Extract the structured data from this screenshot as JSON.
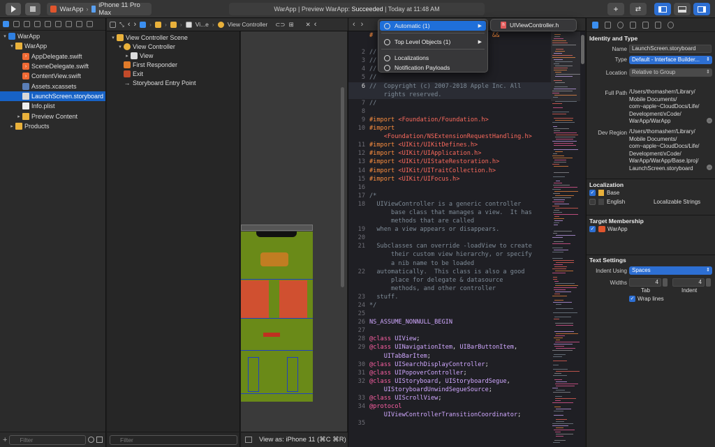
{
  "toolbar": {
    "scheme_name": "WarApp",
    "device": "iPhone 11 Pro Max",
    "status_prefix": "WarApp | Preview WarApp:",
    "status_result": "Succeeded",
    "status_time": "| Today at 11:48 AM"
  },
  "navigator": {
    "items": [
      {
        "label": "WarApp",
        "icon": "app-icon",
        "indent": 0,
        "disclosure": "▾",
        "selected": false
      },
      {
        "label": "WarApp",
        "icon": "folder-icon",
        "indent": 1,
        "disclosure": "▾",
        "selected": false
      },
      {
        "label": "AppDelegate.swift",
        "icon": "swift-file-icon",
        "indent": 2,
        "disclosure": "",
        "selected": false
      },
      {
        "label": "SceneDelegate.swift",
        "icon": "swift-file-icon",
        "indent": 2,
        "disclosure": "",
        "selected": false
      },
      {
        "label": "ContentView.swift",
        "icon": "swift-file-icon",
        "indent": 2,
        "disclosure": "",
        "selected": false
      },
      {
        "label": "Assets.xcassets",
        "icon": "assets-icon",
        "indent": 2,
        "disclosure": "",
        "selected": false
      },
      {
        "label": "LaunchScreen.storyboard",
        "icon": "storyboard-icon",
        "indent": 2,
        "disclosure": "",
        "selected": true
      },
      {
        "label": "Info.plist",
        "icon": "plist-icon",
        "indent": 2,
        "disclosure": "",
        "selected": false
      },
      {
        "label": "Preview Content",
        "icon": "folder-icon",
        "indent": 2,
        "disclosure": "▸",
        "selected": false
      },
      {
        "label": "Products",
        "icon": "folder-icon",
        "indent": 1,
        "disclosure": "▸",
        "selected": false
      }
    ],
    "filter_placeholder": "Filter"
  },
  "jumpbar": {
    "crumbs": [
      "Vi...e",
      "View Controller"
    ]
  },
  "outline": {
    "items": [
      {
        "label": "View Controller Scene",
        "indent": 0,
        "disclosure": "▾",
        "icon": "scene-icon"
      },
      {
        "label": "View Controller",
        "indent": 1,
        "disclosure": "▾",
        "icon": "view-controller-icon"
      },
      {
        "label": "View",
        "indent": 2,
        "disclosure": "▸",
        "icon": "view-icon"
      },
      {
        "label": "First Responder",
        "indent": 1,
        "disclosure": "",
        "icon": "first-responder-icon"
      },
      {
        "label": "Exit",
        "indent": 1,
        "disclosure": "",
        "icon": "exit-icon"
      },
      {
        "label": "Storyboard Entry Point",
        "indent": 1,
        "disclosure": "",
        "icon": "entry-arrow-icon"
      }
    ],
    "filter_placeholder": "Filter"
  },
  "canvas": {
    "view_as": "View as: iPhone 11 (⌘C ⌘R)"
  },
  "menu": {
    "items": [
      {
        "label": "Automatic (1)",
        "selected": true,
        "submenu": true
      },
      {
        "label": "Top Level Objects (1)",
        "selected": false,
        "submenu": true
      },
      {
        "label": "Localizations",
        "selected": false,
        "submenu": false
      },
      {
        "label": "Notification Payloads",
        "selected": false,
        "submenu": false
      }
    ],
    "submenu_item": "UIViewController.h"
  },
  "code": {
    "lines": [
      {
        "n": "",
        "parts": [
          [
            "c-pre",
            "#"
          ],
          [
            "tx",
            "                          "
          ],
          [
            "c-pre",
            "ADERS) &&"
          ]
        ]
      },
      {
        "n": "",
        "parts": [
          [
            "tx",
            ""
          ]
        ]
      },
      {
        "n": "",
        "parts": [
          [
            "tx",
            "                           "
          ],
          [
            "c-str",
            "h>)"
          ]
        ]
      },
      {
        "n": "2",
        "parts": [
          [
            "c-com",
            "//"
          ]
        ]
      },
      {
        "n": "3",
        "parts": [
          [
            "c-com",
            "//  UIViewController.h"
          ]
        ]
      },
      {
        "n": "4",
        "parts": [
          [
            "c-com",
            "//  UIKit"
          ]
        ]
      },
      {
        "n": "5",
        "parts": [
          [
            "c-com",
            "//"
          ]
        ]
      },
      {
        "n": "6",
        "parts": [
          [
            "c-com",
            "//  Copyright (c) 2007-2018 Apple Inc. All"
          ]
        ],
        "hl": true
      },
      {
        "n": "",
        "parts": [
          [
            "c-com",
            "    rights reserved."
          ]
        ],
        "hl": true
      },
      {
        "n": "7",
        "parts": [
          [
            "c-com",
            "//"
          ]
        ]
      },
      {
        "n": "8",
        "parts": [
          [
            "tx",
            ""
          ]
        ]
      },
      {
        "n": "9",
        "parts": [
          [
            "c-pre",
            "#import "
          ],
          [
            "c-str",
            "<Foundation/Foundation.h>"
          ]
        ]
      },
      {
        "n": "10",
        "parts": [
          [
            "c-pre",
            "#import"
          ]
        ]
      },
      {
        "n": "",
        "parts": [
          [
            "c-str",
            "    <Foundation/NSExtensionRequestHandling.h>"
          ]
        ]
      },
      {
        "n": "11",
        "parts": [
          [
            "c-pre",
            "#import "
          ],
          [
            "c-str",
            "<UIKit/UIKitDefines.h>"
          ]
        ]
      },
      {
        "n": "12",
        "parts": [
          [
            "c-pre",
            "#import "
          ],
          [
            "c-str",
            "<UIKit/UIApplication.h>"
          ]
        ]
      },
      {
        "n": "13",
        "parts": [
          [
            "c-pre",
            "#import "
          ],
          [
            "c-str",
            "<UIKit/UIStateRestoration.h>"
          ]
        ]
      },
      {
        "n": "14",
        "parts": [
          [
            "c-pre",
            "#import "
          ],
          [
            "c-str",
            "<UIKit/UITraitCollection.h>"
          ]
        ]
      },
      {
        "n": "15",
        "parts": [
          [
            "c-pre",
            "#import "
          ],
          [
            "c-str",
            "<UIKit/UIFocus.h>"
          ]
        ]
      },
      {
        "n": "16",
        "parts": [
          [
            "tx",
            ""
          ]
        ]
      },
      {
        "n": "17",
        "parts": [
          [
            "c-com",
            "/*"
          ]
        ]
      },
      {
        "n": "18",
        "parts": [
          [
            "c-com",
            "  UIViewController is a generic controller"
          ]
        ]
      },
      {
        "n": "",
        "parts": [
          [
            "c-com",
            "      base class that manages a view.  It has"
          ]
        ]
      },
      {
        "n": "",
        "parts": [
          [
            "c-com",
            "      methods that are called"
          ]
        ]
      },
      {
        "n": "19",
        "parts": [
          [
            "c-com",
            "  when a view appears or disappears."
          ]
        ]
      },
      {
        "n": "20",
        "parts": [
          [
            "tx",
            ""
          ]
        ]
      },
      {
        "n": "21",
        "parts": [
          [
            "c-com",
            "  Subclasses can override -loadView to create"
          ]
        ]
      },
      {
        "n": "",
        "parts": [
          [
            "c-com",
            "      their custom view hierarchy, or specify"
          ]
        ]
      },
      {
        "n": "",
        "parts": [
          [
            "c-com",
            "      a nib name to be loaded"
          ]
        ]
      },
      {
        "n": "22",
        "parts": [
          [
            "c-com",
            "  automatically.  This class is also a good"
          ]
        ]
      },
      {
        "n": "",
        "parts": [
          [
            "c-com",
            "      place for delegate & datasource"
          ]
        ]
      },
      {
        "n": "",
        "parts": [
          [
            "c-com",
            "      methods, and other controller"
          ]
        ]
      },
      {
        "n": "23",
        "parts": [
          [
            "c-com",
            "  stuff."
          ]
        ]
      },
      {
        "n": "24",
        "parts": [
          [
            "c-com",
            "*/"
          ]
        ]
      },
      {
        "n": "25",
        "parts": [
          [
            "tx",
            ""
          ]
        ]
      },
      {
        "n": "26",
        "parts": [
          [
            "c-typ",
            "NS_ASSUME_NONNULL_BEGIN"
          ]
        ]
      },
      {
        "n": "27",
        "parts": [
          [
            "tx",
            ""
          ]
        ]
      },
      {
        "n": "28",
        "parts": [
          [
            "c-key",
            "@class "
          ],
          [
            "c-typ",
            "UIView"
          ],
          [
            "tx",
            ";"
          ]
        ]
      },
      {
        "n": "29",
        "parts": [
          [
            "c-key",
            "@class "
          ],
          [
            "c-typ",
            "UINavigationItem"
          ],
          [
            "tx",
            ", "
          ],
          [
            "c-typ",
            "UIBarButtonItem"
          ],
          [
            "tx",
            ","
          ]
        ]
      },
      {
        "n": "",
        "parts": [
          [
            "tx",
            "    "
          ],
          [
            "c-typ",
            "UITabBarItem"
          ],
          [
            "tx",
            ";"
          ]
        ]
      },
      {
        "n": "30",
        "parts": [
          [
            "c-key",
            "@class "
          ],
          [
            "c-typ",
            "UISearchDisplayController"
          ],
          [
            "tx",
            ";"
          ]
        ]
      },
      {
        "n": "31",
        "parts": [
          [
            "c-key",
            "@class "
          ],
          [
            "c-typ",
            "UIPopoverController"
          ],
          [
            "tx",
            ";"
          ]
        ]
      },
      {
        "n": "32",
        "parts": [
          [
            "c-key",
            "@class "
          ],
          [
            "c-typ",
            "UIStoryboard"
          ],
          [
            "tx",
            ", "
          ],
          [
            "c-typ",
            "UIStoryboardSegue"
          ],
          [
            "tx",
            ","
          ]
        ]
      },
      {
        "n": "",
        "parts": [
          [
            "tx",
            "    "
          ],
          [
            "c-typ",
            "UIStoryboardUnwindSegueSource"
          ],
          [
            "tx",
            ";"
          ]
        ]
      },
      {
        "n": "33",
        "parts": [
          [
            "c-key",
            "@class "
          ],
          [
            "c-typ",
            "UIScrollView"
          ],
          [
            "tx",
            ";"
          ]
        ]
      },
      {
        "n": "34",
        "parts": [
          [
            "c-key",
            "@protocol"
          ]
        ]
      },
      {
        "n": "",
        "parts": [
          [
            "tx",
            "    "
          ],
          [
            "c-typ",
            "UIViewControllerTransitionCoordinator"
          ],
          [
            "tx",
            ";"
          ]
        ]
      },
      {
        "n": "35",
        "parts": [
          [
            "tx",
            ""
          ]
        ]
      }
    ]
  },
  "inspector": {
    "identity_title": "Identity and Type",
    "name_label": "Name",
    "name_value": "LaunchScreen.storyboard",
    "type_label": "Type",
    "type_value": "Default - Interface Builder...",
    "location_label": "Location",
    "location_value": "Relative to Group",
    "full_path_label": "Full Path",
    "full_path_lines": [
      "/Users/thomasherr/Library/",
      "Mobile Documents/",
      "com~apple~CloudDocs/Life/",
      "Development/xCode/",
      "WarApp/WarApp"
    ],
    "dev_region_label": "Dev Region",
    "dev_region_lines": [
      "/Users/thomasherr/Library/",
      "Mobile Documents/",
      "com~apple~CloudDocs/Life/",
      "Development/xCode/",
      "WarApp/WarApp/Base.lproj/",
      "LaunchScreen.storyboard"
    ],
    "localization_title": "Localization",
    "loc_base": "Base",
    "loc_english": "English",
    "loc_english_value": "Localizable Strings",
    "target_title": "Target Membership",
    "target_name": "WarApp",
    "text_title": "Text Settings",
    "indent_label": "Indent Using",
    "indent_value": "Spaces",
    "widths_label": "Widths",
    "tab_value": "4",
    "indent_width_value": "4",
    "tab_label": "Tab",
    "indent_sub_label": "Indent",
    "wrap_label": "Wrap lines"
  }
}
